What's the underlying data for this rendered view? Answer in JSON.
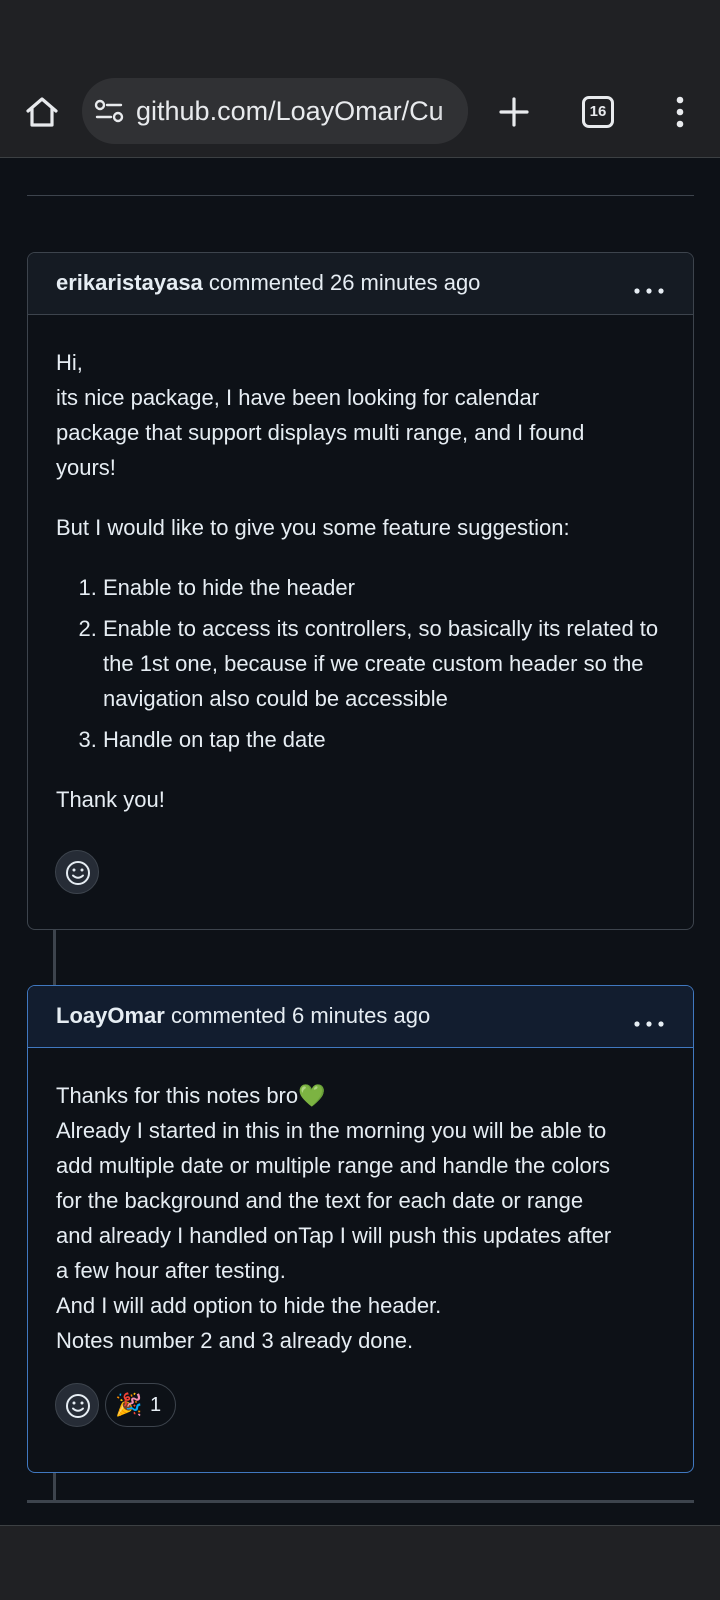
{
  "browser": {
    "url": "github.com/LoayOmar/Cu",
    "tab_count": "16",
    "icons": {
      "home": "home-icon",
      "site_info": "site-settings-icon",
      "new_tab": "plus-icon",
      "tabs": "tab-switcher-icon",
      "menu": "more-vertical-icon"
    }
  },
  "comments": [
    {
      "author": "erikaristayasa",
      "meta": "commented 26 minutes ago",
      "paragraphs": [
        "Hi,",
        "its nice package, I have been looking for calendar",
        "package that support displays multi range, and I found",
        "yours!"
      ],
      "paragraph2": "But I would like to give you some feature suggestion:",
      "list": [
        "Enable to hide the header",
        "Enable to access its controllers, so basically its related to the 1st one, because if we create custom header so the navigation also could be accessible",
        "Handle on tap the date"
      ],
      "closing": "Thank you!"
    },
    {
      "author": "LoayOmar",
      "meta": "commented 6 minutes ago",
      "lines": [
        "Thanks for this notes bro💚",
        "Already I started in this in the morning you will be able to",
        "add multiple date or multiple range and handle the colors",
        "for the background and the text for each date or range",
        "and already I handled onTap I will push this updates after",
        "a few hour after testing.",
        "And I will add option to hide the header.",
        "Notes number 2 and 3 already done."
      ],
      "reaction": {
        "emoji": "🎉",
        "count": "1"
      }
    }
  ],
  "colors": {
    "page_bg": "#0d1117",
    "chrome_bg": "#202124",
    "border": "#3d444d",
    "highlight_border": "#4078c0"
  }
}
